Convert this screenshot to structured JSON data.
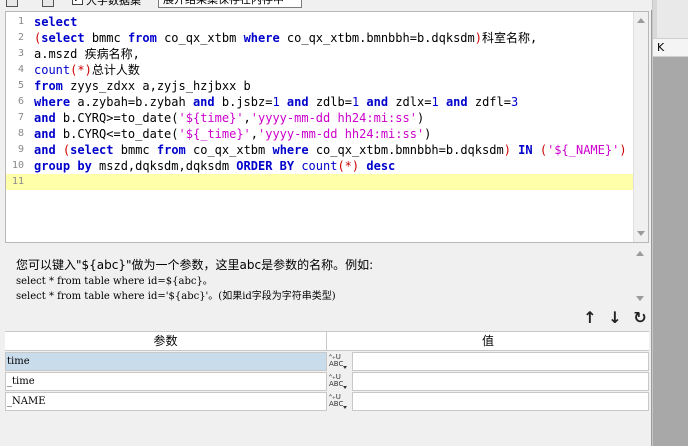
{
  "toolbar": {
    "checkbox_label": "大字数据集",
    "extra_label": "展开结果集保存在内存中"
  },
  "editor": {
    "lines": [
      {
        "n": "1",
        "segs": [
          [
            "kw",
            "select"
          ]
        ]
      },
      {
        "n": "2",
        "segs": [
          [
            "pn",
            "("
          ],
          [
            "kw",
            "select"
          ],
          [
            "t",
            " bmmc "
          ],
          [
            "kw",
            "from"
          ],
          [
            "t",
            " co_qx_xtbm "
          ],
          [
            "kw",
            "where"
          ],
          [
            "t",
            " co_qx_xtbm.bmnbbh=b.dqksdm"
          ],
          [
            "pn",
            ")"
          ],
          [
            "t",
            "科室名称,"
          ]
        ]
      },
      {
        "n": "3",
        "segs": [
          [
            "t",
            "a.mszd 疾病名称,"
          ]
        ]
      },
      {
        "n": "4",
        "segs": [
          [
            "fn",
            "count"
          ],
          [
            "pn",
            "(*)"
          ],
          [
            "t",
            "总计人数"
          ]
        ]
      },
      {
        "n": "5",
        "segs": [
          [
            "kw",
            "from"
          ],
          [
            "t",
            " zyys_zdxx a,zyjs_hzjbxx b"
          ]
        ]
      },
      {
        "n": "6",
        "segs": [
          [
            "kw",
            "where"
          ],
          [
            "t",
            " a.zybah=b.zybah "
          ],
          [
            "kw",
            "and"
          ],
          [
            "t",
            " b.jsbz="
          ],
          [
            "num",
            "1"
          ],
          [
            "t",
            " "
          ],
          [
            "kw",
            "and"
          ],
          [
            "t",
            " zdlb="
          ],
          [
            "num",
            "1"
          ],
          [
            "t",
            " "
          ],
          [
            "kw",
            "and"
          ],
          [
            "t",
            " zdlx="
          ],
          [
            "num",
            "1"
          ],
          [
            "t",
            " "
          ],
          [
            "kw",
            "and"
          ],
          [
            "t",
            " zdfl="
          ],
          [
            "num",
            "3"
          ]
        ]
      },
      {
        "n": "7",
        "segs": [
          [
            "kw",
            "and"
          ],
          [
            "t",
            " b.CYRQ>=to_date("
          ],
          [
            "str",
            "'${time}'"
          ],
          [
            "t",
            ","
          ],
          [
            "str",
            "'yyyy-mm-dd hh24:mi:ss'"
          ],
          [
            "t",
            ")"
          ]
        ]
      },
      {
        "n": "8",
        "segs": [
          [
            "kw",
            "and"
          ],
          [
            "t",
            " b.CYRQ<=to_date("
          ],
          [
            "str",
            "'${_time}'"
          ],
          [
            "t",
            ","
          ],
          [
            "str",
            "'yyyy-mm-dd hh24:mi:ss'"
          ],
          [
            "t",
            ")"
          ]
        ]
      },
      {
        "n": "9",
        "segs": [
          [
            "kw",
            "and"
          ],
          [
            "t",
            " "
          ],
          [
            "pn",
            "("
          ],
          [
            "kw",
            "select"
          ],
          [
            "t",
            " bmmc "
          ],
          [
            "kw",
            "from"
          ],
          [
            "t",
            " co_qx_xtbm "
          ],
          [
            "kw",
            "where"
          ],
          [
            "t",
            " co_qx_xtbm.bmnbbh=b.dqksdm"
          ],
          [
            "pn",
            ")"
          ],
          [
            "t",
            " "
          ],
          [
            "kw",
            "IN"
          ],
          [
            "t",
            " "
          ],
          [
            "pn",
            "("
          ],
          [
            "str",
            "'${_NAME}'"
          ],
          [
            "pn",
            ")"
          ]
        ]
      },
      {
        "n": "10",
        "segs": [
          [
            "kw",
            "group by"
          ],
          [
            "t",
            " mszd,dqksdm,dqksdm "
          ],
          [
            "kw",
            "ORDER BY"
          ],
          [
            "t",
            " "
          ],
          [
            "fn",
            "count"
          ],
          [
            "pn",
            "(*)"
          ],
          [
            "t",
            " "
          ],
          [
            "kw",
            "desc"
          ]
        ]
      },
      {
        "n": "11",
        "segs": []
      }
    ]
  },
  "help": {
    "line1": "您可以键入\"${abc}\"做为一个参数，这里abc是参数的名称。例如:",
    "line2": "select * from table where id=${abc}。",
    "line3": "select * from table where id='${abc}'。(如果id字段为字符串类型)"
  },
  "params": {
    "header_name": "参数",
    "header_value": "值",
    "type_top": "ᴬ₊U",
    "type_bottom": "ABC",
    "rows": [
      {
        "name": "time",
        "value": ""
      },
      {
        "name": "_time",
        "value": ""
      },
      {
        "name": "_NAME",
        "value": ""
      }
    ]
  },
  "buttons": {
    "move_up": "↑",
    "move_down": "↓",
    "refresh": "↻"
  },
  "background": {
    "col_header": "K"
  },
  "colors": {
    "keyword": "#0000cc",
    "string": "#cc00cc",
    "paren": "#cc0000",
    "current_line": "#ffffaa",
    "selected_row": "#c9dcec"
  }
}
